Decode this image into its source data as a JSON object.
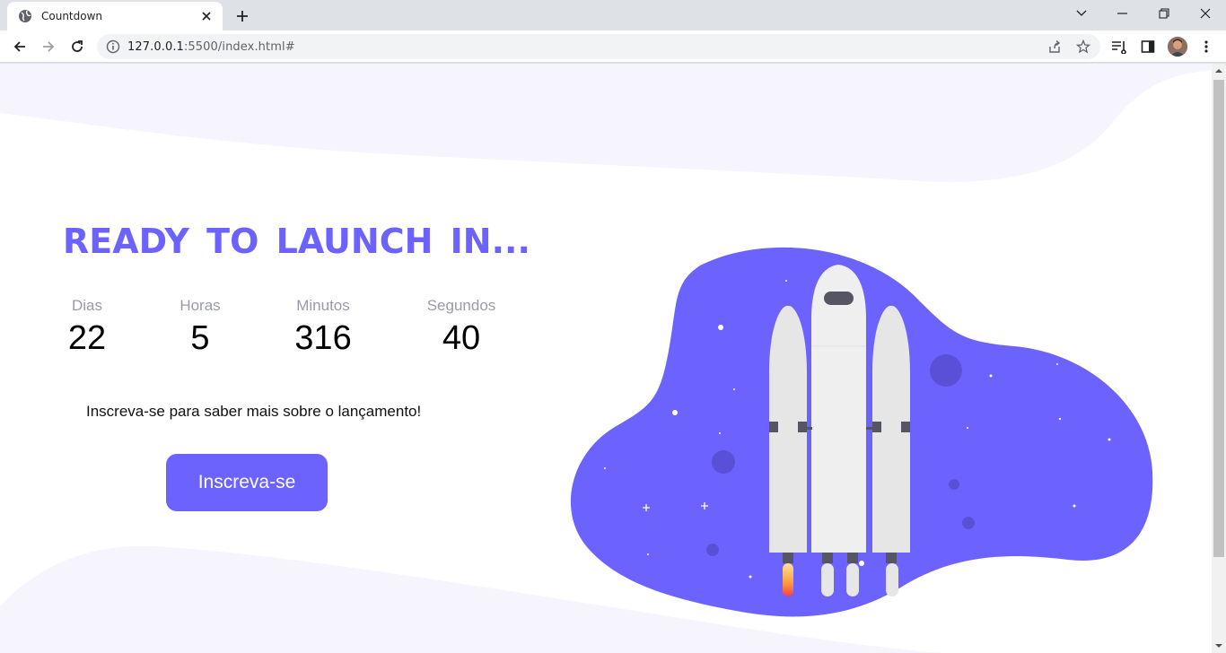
{
  "browser": {
    "tab_title": "Countdown",
    "url_host": "127.0.0.1",
    "url_rest": ":5500/index.html#"
  },
  "page": {
    "headline": "READY TO LAUNCH IN...",
    "counters": [
      {
        "label": "Dias",
        "value": "22"
      },
      {
        "label": "Horas",
        "value": "5"
      },
      {
        "label": "Minutos",
        "value": "316"
      },
      {
        "label": "Segundos",
        "value": "40"
      }
    ],
    "subtitle": "Inscreva-se para saber mais sobre o lançamento!",
    "cta_label": "Inscreva-se"
  },
  "colors": {
    "accent": "#6c63ff",
    "wave": "#f6f5fd",
    "rocket_body": "#e6e6e6",
    "rocket_dark": "#555564"
  },
  "icons": [
    "globe-icon",
    "close-icon",
    "plus-icon",
    "chevron-down-icon",
    "minimize-icon",
    "restore-icon",
    "back-arrow-icon",
    "forward-arrow-icon",
    "reload-icon",
    "info-icon",
    "share-icon",
    "star-icon",
    "reading-list-icon",
    "side-panel-icon",
    "kebab-menu-icon",
    "rocket-illustration"
  ]
}
